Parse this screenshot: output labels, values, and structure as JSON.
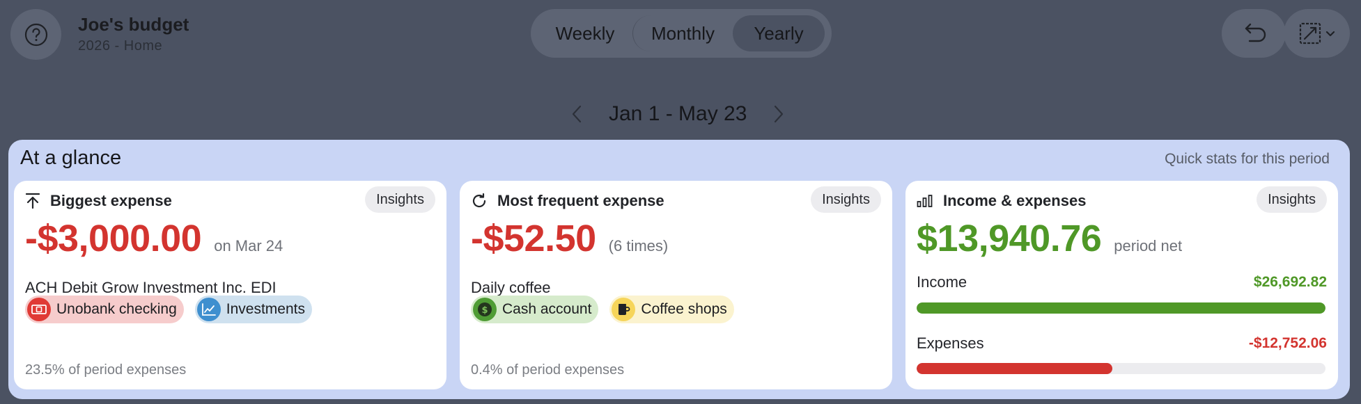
{
  "header": {
    "title": "Joe's budget",
    "subtitle": "2026 - Home",
    "periods": [
      "Weekly",
      "Monthly",
      "Yearly"
    ],
    "selected_period": "Yearly",
    "icons": [
      "question-icon",
      "return-icon",
      "resize-icon",
      "chevron-down-icon"
    ]
  },
  "date_nav": {
    "range": "Jan 1 - May 23"
  },
  "glance": {
    "title": "At a glance",
    "subtitle": "Quick stats for this period",
    "insights_label": "Insights",
    "biggest": {
      "label": "Biggest expense",
      "amount": "-$3,000.00",
      "date": "on Mar 24",
      "description": "ACH Debit Grow Investment Inc. EDI",
      "tags": [
        {
          "label": "Unobank checking",
          "color": "#f6cccc",
          "icon_color": "#e03a35",
          "icon": "banknote-icon"
        },
        {
          "label": "Investments",
          "color": "#cfe1ef",
          "icon_color": "#3e8fcf",
          "icon": "chart-line-icon"
        }
      ],
      "percent": "23.5% of period expenses"
    },
    "frequent": {
      "label": "Most frequent expense",
      "amount": "-$52.50",
      "times": "(6 times)",
      "description": "Daily coffee",
      "tags": [
        {
          "label": "Cash account",
          "color": "#d6ebcc",
          "icon_color": "#4f9c35",
          "icon": "dollar-coin-icon"
        },
        {
          "label": "Coffee shops",
          "color": "#fbf3cf",
          "icon_color": "#f6d55a",
          "icon": "coffee-cup-icon"
        }
      ],
      "percent": "0.4% of period expenses"
    },
    "income_expenses": {
      "label": "Income & expenses",
      "net": "$13,940.76",
      "net_label": "period net",
      "income_label": "Income",
      "income_value": "$26,692.82",
      "income_fraction": 1.0,
      "expenses_label": "Expenses",
      "expenses_value": "-$12,752.06",
      "expenses_fraction": 0.478,
      "colors": {
        "income": "#4f9827",
        "expense": "#d3342f"
      }
    }
  }
}
